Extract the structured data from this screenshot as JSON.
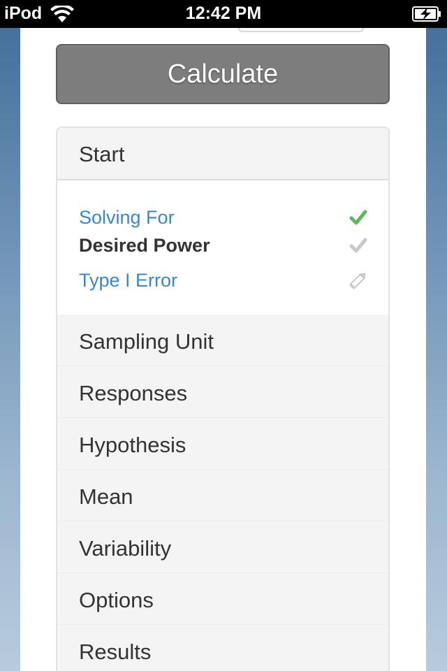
{
  "status_bar": {
    "carrier": "iPod",
    "time": "12:42 PM"
  },
  "actions": {
    "calculate_label": "Calculate"
  },
  "accordion": {
    "header": "Start",
    "rows": [
      {
        "label": "Solving For",
        "state": "complete",
        "icon": "check-green-icon"
      },
      {
        "label": "Desired Power",
        "state": "current",
        "icon": "check-gray-icon"
      },
      {
        "label": "Type I Error",
        "state": "editable",
        "icon": "pencil-icon"
      }
    ],
    "sections": [
      "Sampling Unit",
      "Responses",
      "Hypothesis",
      "Mean",
      "Variability",
      "Options",
      "Results"
    ]
  },
  "colors": {
    "link": "#3a87c8",
    "check_green": "#5cb85c",
    "button": "#7d7d7d"
  }
}
